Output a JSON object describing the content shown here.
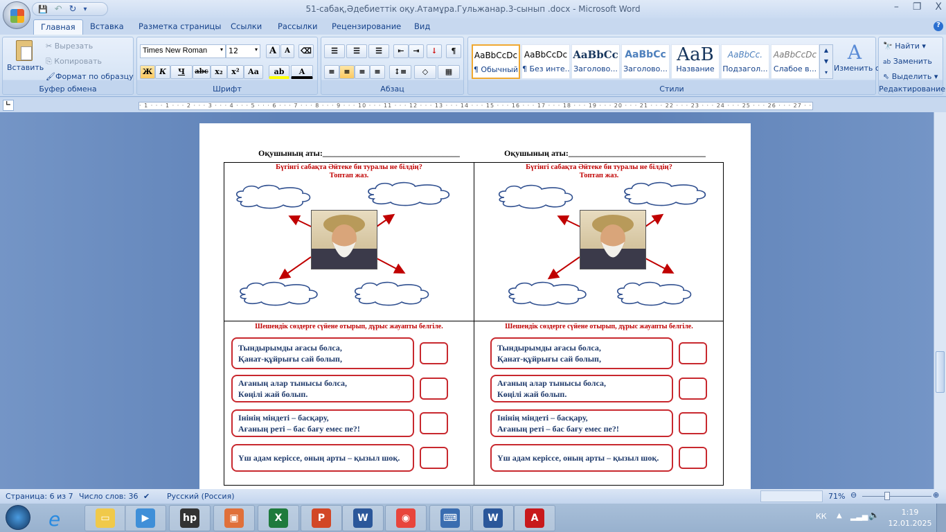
{
  "window": {
    "title": "51-сабақ,Әдебиеттік оқу.Атамұра.Гульжанар.3-сынып .docx - Microsoft Word",
    "minimize": "–",
    "restore": "❐",
    "close": "X"
  },
  "qat": {
    "save": "💾",
    "undo": "↶",
    "redo": "↻",
    "more": "▾"
  },
  "tabs": [
    "Главная",
    "Вставка",
    "Разметка страницы",
    "Ссылки",
    "Рассылки",
    "Рецензирование",
    "Вид"
  ],
  "ribbon": {
    "clipboard": {
      "label": "Буфер обмена",
      "paste": "Вставить",
      "cut": "Вырезать",
      "copy": "Копировать",
      "format_painter": "Формат по образцу"
    },
    "font": {
      "label": "Шрифт",
      "font_name": "Times New Roman",
      "font_size": "12",
      "grow": "A",
      "shrink": "A",
      "bold": "Ж",
      "italic": "К",
      "underline": "Ч",
      "strike": "abc",
      "sub": "x₂",
      "sup": "x²",
      "case": "Aa"
    },
    "paragraph": {
      "label": "Абзац",
      "pilcrow": "¶"
    },
    "styles": {
      "label": "Стили",
      "items": [
        {
          "sample": "AaBbCcDc",
          "name": "¶ Обычный"
        },
        {
          "sample": "AaBbCcDc",
          "name": "¶ Без инте..."
        },
        {
          "sample": "AaBbCc",
          "name": "Заголово..."
        },
        {
          "sample": "AaBbCc",
          "name": "Заголово..."
        },
        {
          "sample": "AaB",
          "name": "Название"
        },
        {
          "sample": "AaBbCc.",
          "name": "Подзагол..."
        },
        {
          "sample": "AaBbCcDc",
          "name": "Слабое в..."
        }
      ],
      "change": "Изменить стили"
    },
    "editing": {
      "label": "Редактирование",
      "find": "Найти",
      "replace": "Заменить",
      "select": "Выделить"
    }
  },
  "ruler": "· 1 · · · 1 · · · 2 · · · 3 · · · 4 · · · 5 · · · 6 · · · 7 · · · 8 · · · 9 · · · 10 · · · 11 · · · 12 · · · 13 · · · 14 · · · 15 · · · 16 · · · 17 · · · 18 · · · 19 · · · 20 · · · 21 · · · 22 · · · 23 · · · 24 · · · 25 · · · 26 · · · 27 · · · 28",
  "document": {
    "student_name": "Оқушының аты:_________________________________",
    "q1_line1": "Бүгінгі сабақта Әйтеке   би туралы не білдің?",
    "q1_line2": "Топтап жаз.",
    "q2": "Шешендік сөздерге  сүйене отырып, дұрыс жауапты белгіле.",
    "quotes": [
      [
        "Тындырымды ағасы болса,",
        "Қанат-құйрығы сай болып,"
      ],
      [
        "Ағаның алар тынысы болса,",
        "Көңілі жай болып."
      ],
      [
        "Інінің міндеті – басқару,",
        "Ағаның реті – бас бағу емес пе?!"
      ],
      [
        "Үш адам керіссе, оның арты – қызыл шоқ.",
        ""
      ]
    ]
  },
  "status": {
    "page": "Страница: 6 из 7",
    "words": "Число слов: 36",
    "language": "Русский (Россия)",
    "zoom": "71%",
    "zoom_percent": 71
  },
  "taskbar": {
    "lang": "КК",
    "time": "1:19",
    "date": "12.01.2025"
  },
  "colors": {
    "accent_red": "#c00000",
    "quote_text": "#1f3a6b",
    "cloud": "#2f4f8f",
    "ribbon_text": "#15428b"
  }
}
